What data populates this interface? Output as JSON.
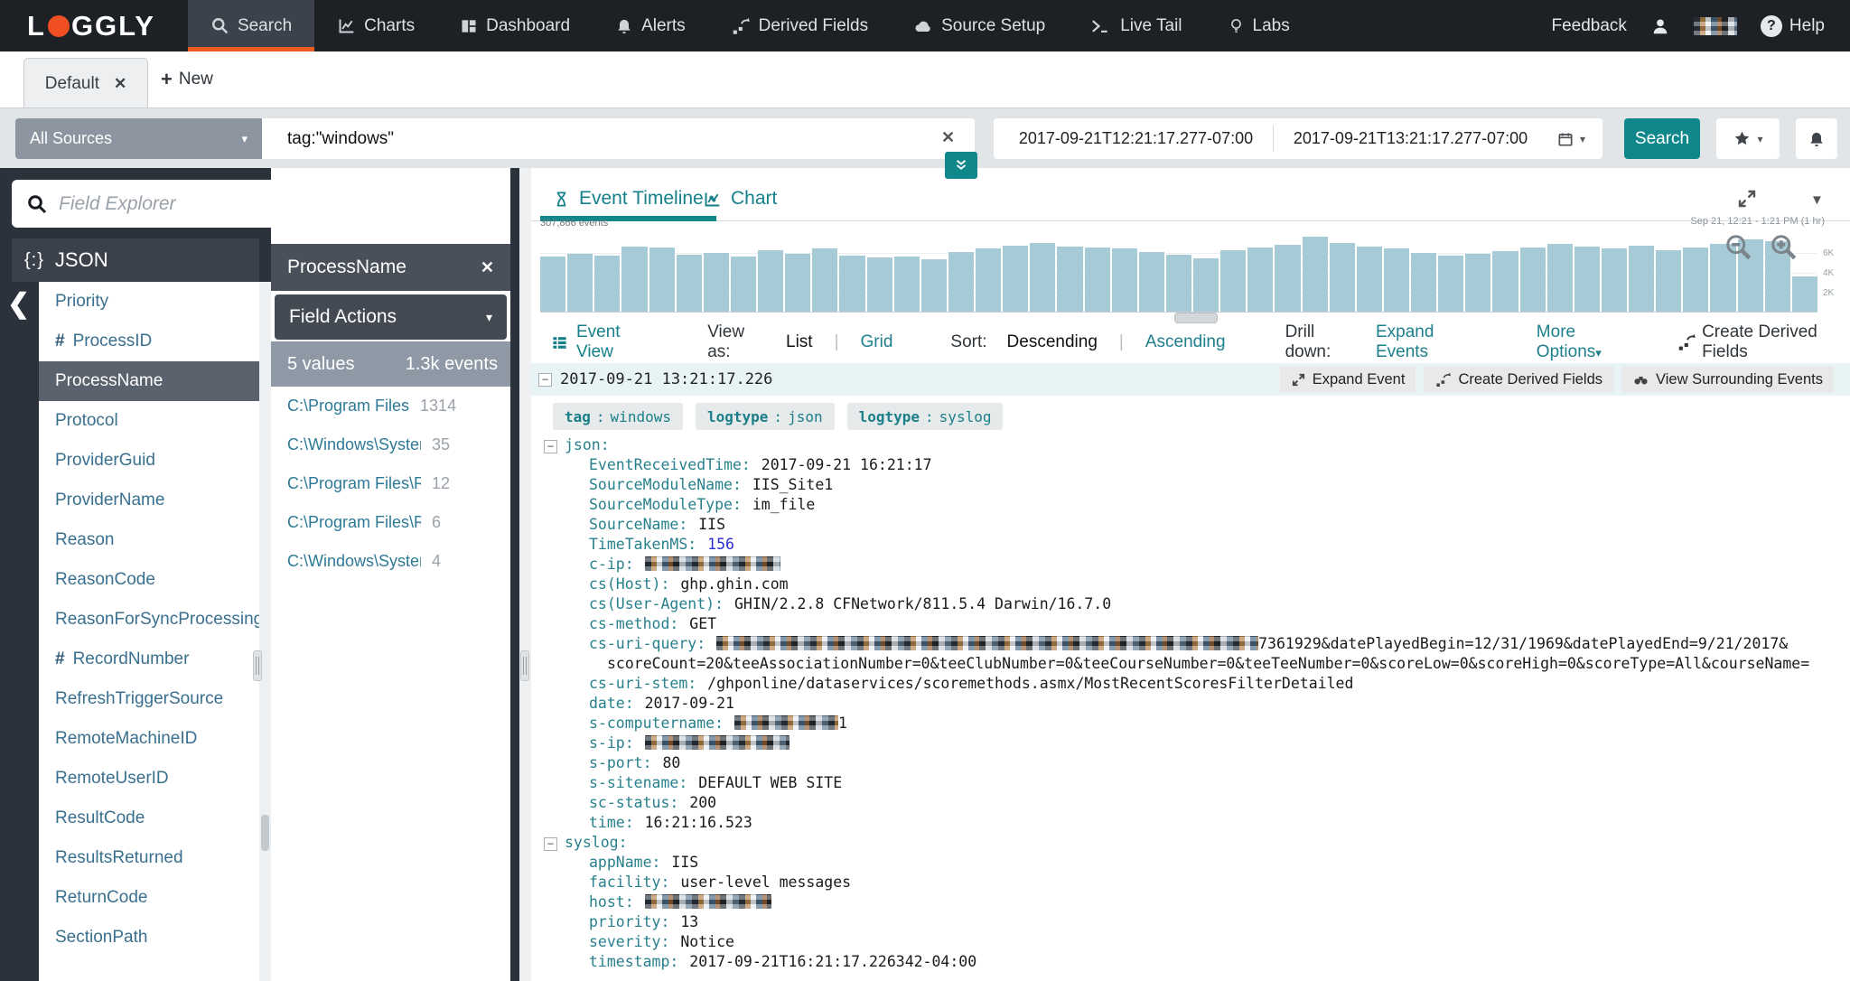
{
  "topbar": {
    "logo_pre": "L",
    "logo_post": "GGLY",
    "items": [
      {
        "label": "Search",
        "icon": "search",
        "state": "active"
      },
      {
        "label": "Charts",
        "icon": "charts"
      },
      {
        "label": "Dashboard",
        "icon": "dashboard"
      },
      {
        "label": "Alerts",
        "icon": "alerts"
      },
      {
        "label": "Derived Fields",
        "icon": "derived"
      },
      {
        "label": "Source Setup",
        "icon": "cloud"
      },
      {
        "label": "Live Tail",
        "icon": "terminal"
      },
      {
        "label": "Labs",
        "icon": "bulb"
      }
    ],
    "feedback": "Feedback",
    "help": "Help"
  },
  "tabs": {
    "current": "Default",
    "close": "✕",
    "plus": "+",
    "new": "New"
  },
  "search": {
    "source_selector": "All Sources",
    "query": "tag:\"windows\"",
    "clear": "✕",
    "from": "2017-09-21T12:21:17.277-07:00",
    "to": "2017-09-21T13:21:17.277-07:00",
    "button": "Search",
    "caret": "▾"
  },
  "field_explorer": {
    "placeholder": "Field Explorer",
    "group_icon": "{:}",
    "group": "JSON",
    "collapse": "❮",
    "fields": [
      {
        "label": "Priority"
      },
      {
        "label": "ProcessID",
        "hash": "#"
      },
      {
        "label": "ProcessName",
        "state": "selected"
      },
      {
        "label": "Protocol"
      },
      {
        "label": "ProviderGuid"
      },
      {
        "label": "ProviderName"
      },
      {
        "label": "Reason"
      },
      {
        "label": "ReasonCode"
      },
      {
        "label": "ReasonForSyncProcessing"
      },
      {
        "label": "RecordNumber",
        "hash": "#"
      },
      {
        "label": "RefreshTriggerSource"
      },
      {
        "label": "RemoteMachineID"
      },
      {
        "label": "RemoteUserID"
      },
      {
        "label": "ResultCode"
      },
      {
        "label": "ResultsReturned"
      },
      {
        "label": "ReturnCode"
      },
      {
        "label": "SectionPath"
      }
    ]
  },
  "popup": {
    "title": "ProcessName",
    "close": "✕",
    "actions": "Field Actions",
    "caret": "▾",
    "values_count": "5 values",
    "events_count": "1.3k events",
    "values": [
      {
        "value": "C:\\Program Files",
        "count": "1314"
      },
      {
        "value": "C:\\Windows\\Syster",
        "count": "35"
      },
      {
        "value": "C:\\Program Files\\R",
        "count": "12"
      },
      {
        "value": "C:\\Program Files\\Re",
        "count": "6"
      },
      {
        "value": "C:\\Windows\\System",
        "count": "4"
      }
    ]
  },
  "timeline": {
    "tabs": [
      {
        "label": "Event Timeline",
        "icon": "hourglass",
        "state": "active"
      },
      {
        "label": "Chart",
        "icon": "chartline"
      }
    ],
    "events_label": "307,866 events",
    "range_label": "Sep 21, 12:21 - 1:21 PM  (1 hr)"
  },
  "chart_data": {
    "type": "bar",
    "title": "Event Timeline histogram",
    "total_events": "307,866",
    "x_range": [
      "2017-09-21 12:21",
      "2017-09-21 13:21"
    ],
    "ylim": [
      0,
      8000
    ],
    "ytick_labels": [
      "6K",
      "4K",
      "2K"
    ],
    "ytick_values": [
      6000,
      4000,
      2000
    ],
    "values": [
      5600,
      5900,
      5700,
      6600,
      6500,
      5800,
      6000,
      5600,
      6300,
      5900,
      6400,
      5700,
      5500,
      5600,
      5300,
      6100,
      6400,
      6700,
      7000,
      6600,
      6500,
      6400,
      6100,
      5800,
      5400,
      6300,
      6500,
      6800,
      7600,
      7000,
      6600,
      6400,
      6000,
      5700,
      5900,
      6200,
      6500,
      6900,
      6600,
      6400,
      6700,
      6300,
      6500,
      6900,
      7400,
      7200,
      3600
    ]
  },
  "toolbar": {
    "event_view": "Event View",
    "view_as": "View as:",
    "list": "List",
    "grid": "Grid",
    "pipe": "|",
    "sort": "Sort:",
    "descending": "Descending",
    "ascending": "Ascending",
    "drill": "Drill down:",
    "expand_events": "Expand Events",
    "more_options": "More Options",
    "caret": "▾",
    "create_derived": "Create Derived Fields"
  },
  "event": {
    "collapse": "−",
    "timestamp": "2017-09-21 13:21:17.226",
    "buttons": [
      {
        "label": "Expand Event",
        "icon": "expand"
      },
      {
        "label": "Create Derived Fields",
        "icon": "derived2"
      },
      {
        "label": "View Surrounding Events",
        "icon": "binoculars"
      }
    ],
    "chips": [
      {
        "label": "tag",
        "value": "windows"
      },
      {
        "label": "logtype",
        "value": "json"
      },
      {
        "label": "logtype",
        "value": "syslog"
      }
    ],
    "json_lines": [
      {
        "group": true,
        "key": "json"
      },
      {
        "key": "EventReceivedTime",
        "value": "2017-09-21 16:21:17"
      },
      {
        "key": "SourceModuleName",
        "value": "IIS_Site1"
      },
      {
        "key": "SourceModuleType",
        "value": "im_file"
      },
      {
        "key": "SourceName",
        "value": "IIS"
      },
      {
        "key": "TimeTakenMS",
        "value": "156",
        "num": true
      },
      {
        "key": "c-ip",
        "redact": 150
      },
      {
        "key": "cs(Host)",
        "value": "ghp.ghin.com"
      },
      {
        "key": "cs(User-Agent)",
        "value": "GHIN/2.2.8 CFNetwork/811.5.4 Darwin/16.7.0"
      },
      {
        "key": "cs-method",
        "value": "GET"
      },
      {
        "key": "cs-uri-query",
        "redact": 600,
        "value": "7361929&datePlayedBegin=12/31/1969&datePlayedEnd=9/21/2017&",
        "wrap": "scoreCount=20&teeAssociationNumber=0&teeClubNumber=0&teeCourseNumber=0&teeTeeNumber=0&scoreLow=0&scoreHigh=0&scoreType=All&courseName="
      },
      {
        "key": "cs-uri-stem",
        "value": "/ghponline/dataservices/scoremethods.asmx/MostRecentScoresFilterDetailed"
      },
      {
        "key": "date",
        "value": "2017-09-21"
      },
      {
        "key": "s-computername",
        "redact": 115,
        "value": "1"
      },
      {
        "key": "s-ip",
        "redact": 160
      },
      {
        "key": "s-port",
        "value": "80"
      },
      {
        "key": "s-sitename",
        "value": "DEFAULT WEB SITE"
      },
      {
        "key": "sc-status",
        "value": "200"
      },
      {
        "key": "time",
        "value": "16:21:16.523"
      },
      {
        "group": true,
        "key": "syslog"
      },
      {
        "key": "appName",
        "value": "IIS"
      },
      {
        "key": "facility",
        "value": "user-level messages"
      },
      {
        "key": "host",
        "redact": 140
      },
      {
        "key": "priority",
        "value": "13"
      },
      {
        "key": "severity",
        "value": "Notice"
      },
      {
        "key": "timestamp",
        "value": "2017-09-21T16:21:17.226342-04:00"
      }
    ]
  }
}
